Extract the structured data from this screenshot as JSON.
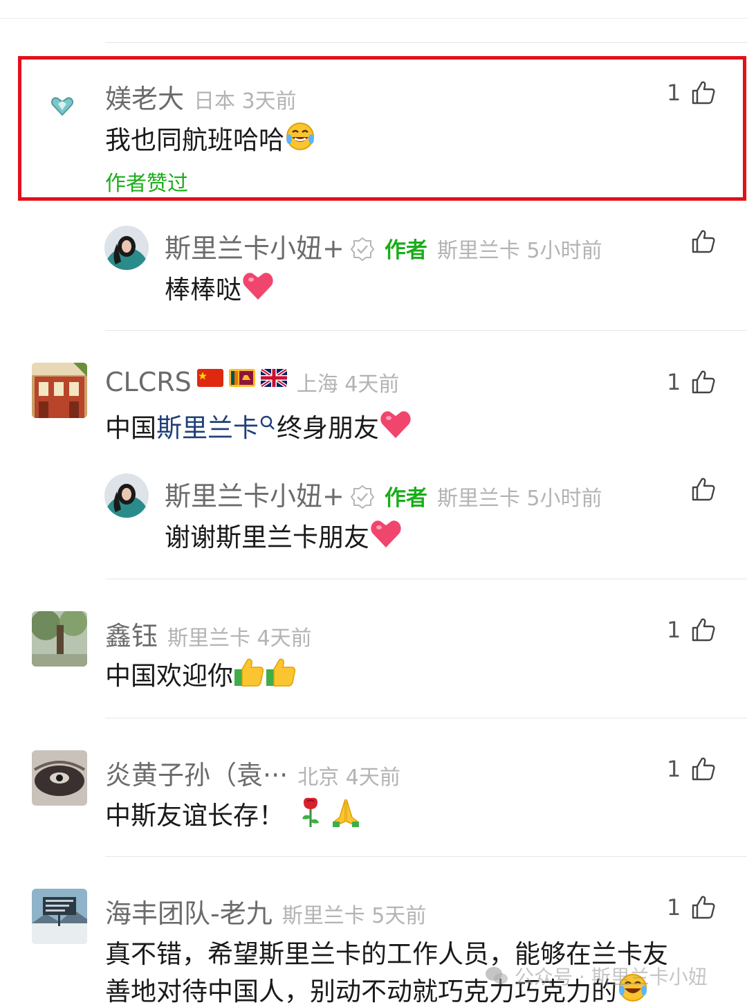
{
  "comments": [
    {
      "name": "媄老大",
      "meta": "日本 3天前",
      "text": "我也同航班哈哈",
      "author_liked": "作者赞过",
      "likes": "1",
      "avatar_icon": "heart-diamond-icon"
    },
    {
      "name": "斯里兰卡小妞+",
      "author_tag": "作者",
      "meta": "斯里兰卡 5小时前",
      "text": "棒棒哒",
      "reply": true
    },
    {
      "name": "CLCRS",
      "meta": "上海 4天前",
      "text_pre": "中国",
      "text_link": "斯里兰卡",
      "text_post": "终身朋友",
      "likes": "1",
      "flags": [
        "china-flag",
        "sri-lanka-flag",
        "uk-flag"
      ]
    },
    {
      "name": "斯里兰卡小妞+",
      "author_tag": "作者",
      "meta": "斯里兰卡 5小时前",
      "text": "谢谢斯里兰卡朋友",
      "reply": true
    },
    {
      "name": "鑫钰",
      "meta": "斯里兰卡 4天前",
      "text": "中国欢迎你",
      "likes": "1"
    },
    {
      "name": "炎黄子孙（袁···",
      "meta": "北京 4天前",
      "text": "中斯友谊长存！",
      "likes": "1"
    },
    {
      "name": "海丰团队-老九",
      "meta": "斯里兰卡 5天前",
      "text_line1": "真不错，希望斯里兰卡的工作人员，能够在兰卡友",
      "text_line2": "善地对待中国人，别动不动就巧克力巧克力的",
      "likes": "1"
    }
  ],
  "watermark": "公众号 · 斯里兰卡小妞",
  "colors": {
    "highlight_border": "#e3101a",
    "author_green": "#1aad19",
    "link_blue": "#1f3f7a",
    "meta_gray": "#b3b3b3",
    "name_gray": "#6b6b6b"
  }
}
